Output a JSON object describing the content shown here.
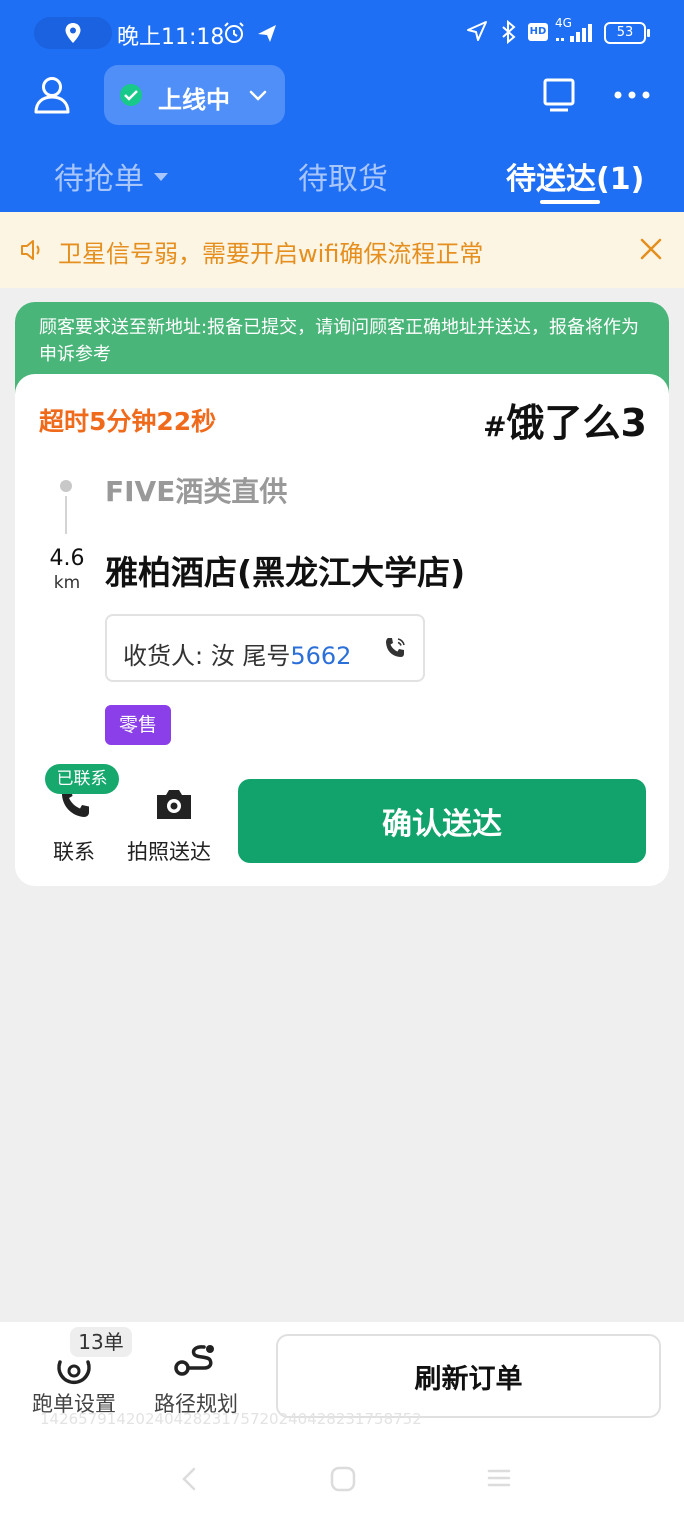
{
  "status_bar": {
    "time": "晚上11:18",
    "network": "4G",
    "hd": "HD",
    "battery": "53"
  },
  "header": {
    "online_status": "上线中",
    "tabs": [
      {
        "label": "待抢单",
        "active": false
      },
      {
        "label": "待取货",
        "active": false
      },
      {
        "label": "待送达(1)",
        "active": true
      }
    ]
  },
  "warning": {
    "text": "卫星信号弱，需要开启wifi确保流程正常"
  },
  "order": {
    "notice": "顾客要求送至新地址:报备已提交，请询问顾客正确地址并送达，报备将作为申诉参考",
    "timeout": "超时5分钟22秒",
    "order_hash": "#",
    "order_label": "饿了么3",
    "shop": "FIVE酒类直供",
    "distance_value": "4.6",
    "distance_unit": "km",
    "destination": "雅柏酒店(黑龙江大学店)",
    "receiver_label": "收货人: 汝 尾号",
    "receiver_phone_tail": "5662",
    "tag": "零售",
    "contacted_badge": "已联系",
    "contact_label": "联系",
    "photo_label": "拍照送达",
    "confirm_label": "确认送达"
  },
  "bottom": {
    "order_count": "13单",
    "run_settings_label": "跑单设置",
    "route_label": "路径规划",
    "refresh_label": "刷新订单",
    "order_id": "1426579142024042823175720240428231758752"
  },
  "colors": {
    "header_blue": "#1f6ff5",
    "warning_orange": "#e48f1f",
    "timeout_orange": "#f06a1c",
    "notice_green": "#49b579",
    "confirm_green": "#11a36b",
    "tag_purple": "#8a3fe8",
    "phone_blue": "#2b6fd8"
  }
}
